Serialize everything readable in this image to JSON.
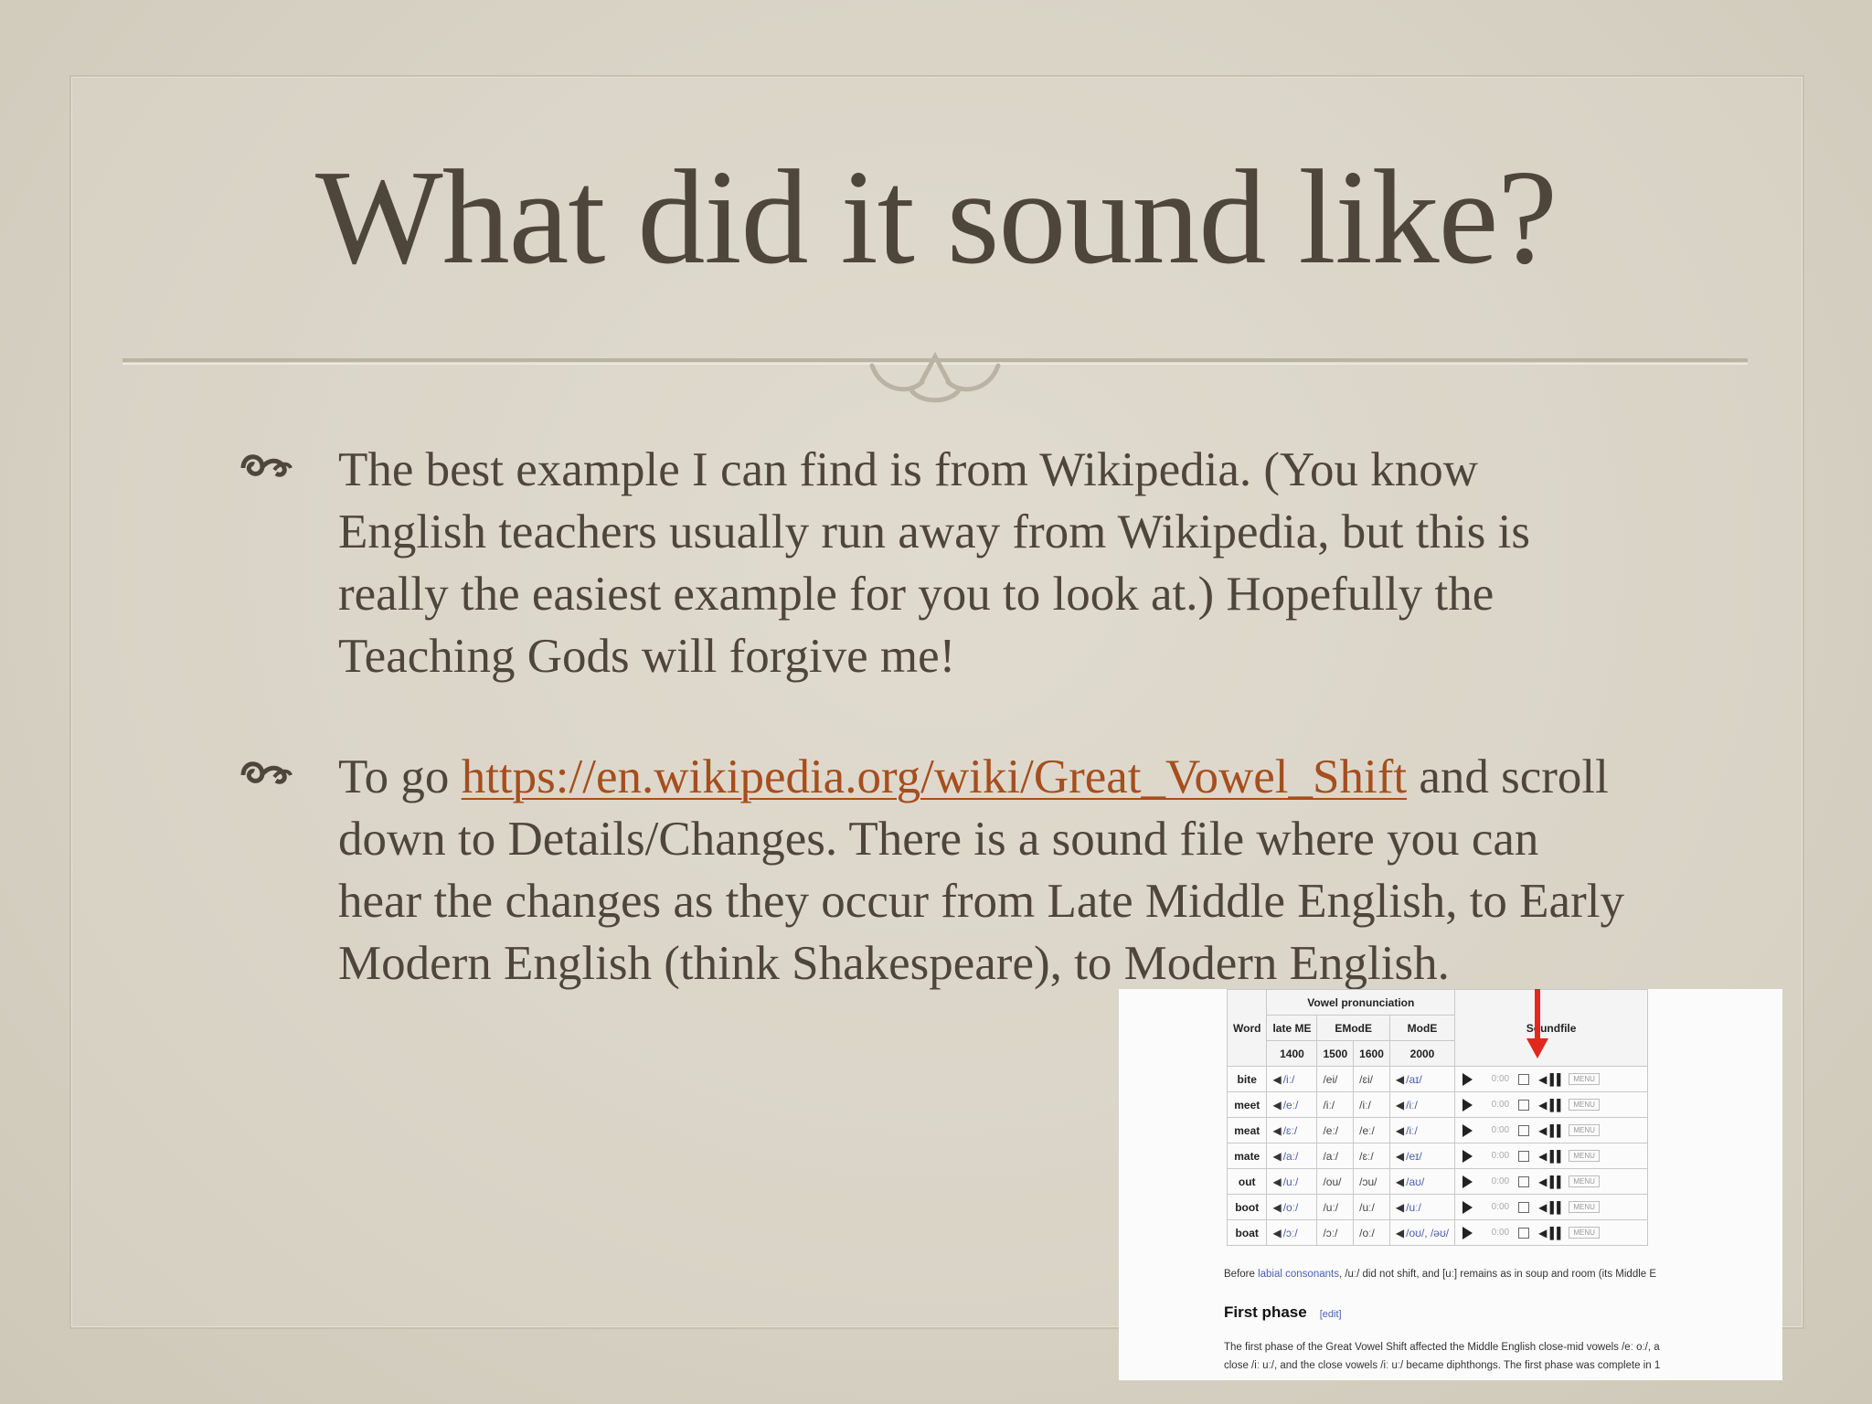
{
  "slide": {
    "title": "What did it sound like?",
    "bullets": [
      {
        "text": "The best example I can find is from Wikipedia. (You know English teachers usually run away from Wikipedia, but this is really the easiest example for you to look at.) Hopefully the Teaching Gods will forgive me!"
      },
      {
        "prefix": "To go ",
        "link": "https://en.wikipedia.org/wiki/Great_Vowel_Shift",
        "suffix": " and scroll down to Details/Changes. There is a sound file where you can hear the changes as they occur from Late Middle English, to Early Modern English (think Shakespeare), to Modern English."
      }
    ],
    "colors": {
      "text": "#4f463b",
      "link": "#a64e1d",
      "background": "#d8d3c5"
    }
  },
  "wiki": {
    "header_group": "Vowel pronunciation",
    "headers": {
      "word": "Word",
      "late_me": "late ME",
      "emode": "EModE",
      "mode": "ModE",
      "soundfile": "Soundfile"
    },
    "years": [
      "1400",
      "1500",
      "1600",
      "2000"
    ],
    "rows": [
      {
        "word": "bite",
        "c1": "/iː/",
        "c2": "/ei/",
        "c3": "/ɛi/",
        "c4": "/aɪ/"
      },
      {
        "word": "meet",
        "c1": "/eː/",
        "c2": "/iː/",
        "c3": "/iː/",
        "c4": "/iː/"
      },
      {
        "word": "meat",
        "c1": "/ɛː/",
        "c2": "/eː/",
        "c3": "/eː/",
        "c4": "/iː/"
      },
      {
        "word": "mate",
        "c1": "/aː/",
        "c2": "/aː/",
        "c3": "/ɛː/",
        "c4": "/eɪ/"
      },
      {
        "word": "out",
        "c1": "/uː/",
        "c2": "/ou/",
        "c3": "/ɔu/",
        "c4": "/aʊ/"
      },
      {
        "word": "boot",
        "c1": "/oː/",
        "c2": "/uː/",
        "c3": "/uː/",
        "c4": "/uː/"
      },
      {
        "word": "boat",
        "c1": "/ɔː/",
        "c2": "/ɔː/",
        "c3": "/oː/",
        "c4": "/oʊ/, /əʊ/"
      }
    ],
    "player": {
      "time": "0:00",
      "menu": "MENU"
    },
    "note_prefix": "Before ",
    "note_link": "labial consonants",
    "note_suffix": ", /uː/ did not shift, and [uː] remains as in soup and room (its Middle E",
    "section_heading": "First phase",
    "section_edit": "[edit]",
    "para_line1": "The first phase of the Great Vowel Shift affected the Middle English close-mid vowels /eː oː/, a",
    "para_line2": "close /iː uː/, and the close vowels /iː uː/ became diphthongs. The first phase was complete in 1"
  }
}
